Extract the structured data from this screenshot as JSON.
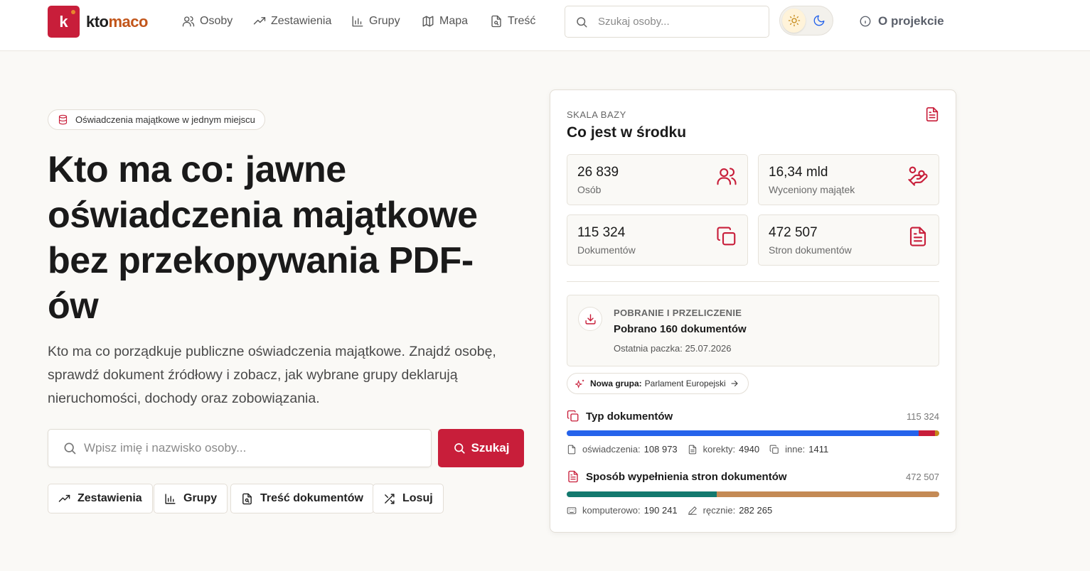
{
  "nav": {
    "logo_letter": "k",
    "logo_text_a": "kto",
    "logo_text_b": "maco",
    "links": [
      {
        "label": "Osoby",
        "icon": "users-icon"
      },
      {
        "label": "Zestawienia",
        "icon": "trending-up-icon"
      },
      {
        "label": "Grupy",
        "icon": "bar-chart-icon"
      },
      {
        "label": "Mapa",
        "icon": "map-icon"
      },
      {
        "label": "Treść",
        "icon": "document-search-icon"
      }
    ],
    "search_placeholder": "Szukaj osoby...",
    "about_label": "O projekcie"
  },
  "hero": {
    "pill": "Oświadczenia majątkowe w jednym miejscu",
    "title": "Kto ma co: jawne oświadczenia majątkowe bez przekopywania PDF-ów",
    "description": "Kto ma co porządkuje publiczne oświadczenia majątkowe. Znajdź osobę, sprawdź dokument źródłowy i zobacz, jak wybrane grupy deklarują nieruchomości, dochody oraz zobowiązania.",
    "search_placeholder": "Wpisz imię i nazwisko osoby...",
    "search_button": "Szukaj",
    "quick_links": [
      "Zestawienia",
      "Grupy",
      "Treść dokumentów",
      "Losuj"
    ]
  },
  "stats_card": {
    "eyebrow": "SKALA BAZY",
    "title": "Co jest w środku",
    "stats": [
      {
        "value": "26 839",
        "label": "Osób",
        "icon": "users-icon"
      },
      {
        "value": "16,34 mld",
        "label": "Wyceniony majątek",
        "icon": "hand-coins-icon"
      },
      {
        "value": "115 324",
        "label": "Dokumentów",
        "icon": "copy-icon"
      },
      {
        "value": "472 507",
        "label": "Stron dokumentów",
        "icon": "file-text-icon"
      }
    ],
    "download": {
      "eyebrow": "POBRANIE I PRZELICZENIE",
      "title": "Pobrano 160 dokumentów",
      "subtitle": "Ostatnia paczka: 25.07.2026"
    },
    "new_group": {
      "prefix": "Nowa grupa:",
      "name": "Parlament Europejski"
    },
    "doc_types": {
      "title": "Typ dokumentów",
      "total": "115 324",
      "segments": [
        {
          "label": "oświadczenia:",
          "value": "108 973",
          "raw": 108973,
          "color": "#2563eb"
        },
        {
          "label": "korekty:",
          "value": "4940",
          "raw": 4940,
          "color": "#c81e3a"
        },
        {
          "label": "inne:",
          "value": "1411",
          "raw": 1411,
          "color": "#c58a1a"
        }
      ]
    },
    "fill_method": {
      "title": "Sposób wypełnienia stron dokumentów",
      "total": "472 507",
      "segments": [
        {
          "label": "komputerowo:",
          "value": "190 241",
          "raw": 190241,
          "color": "#13796e"
        },
        {
          "label": "ręcznie:",
          "value": "282 265",
          "raw": 282265,
          "color": "#c48a55"
        }
      ]
    }
  },
  "colors": {
    "brand": "#c81e3a",
    "brand_secondary": "#c2561b",
    "background": "#faf9f6"
  }
}
